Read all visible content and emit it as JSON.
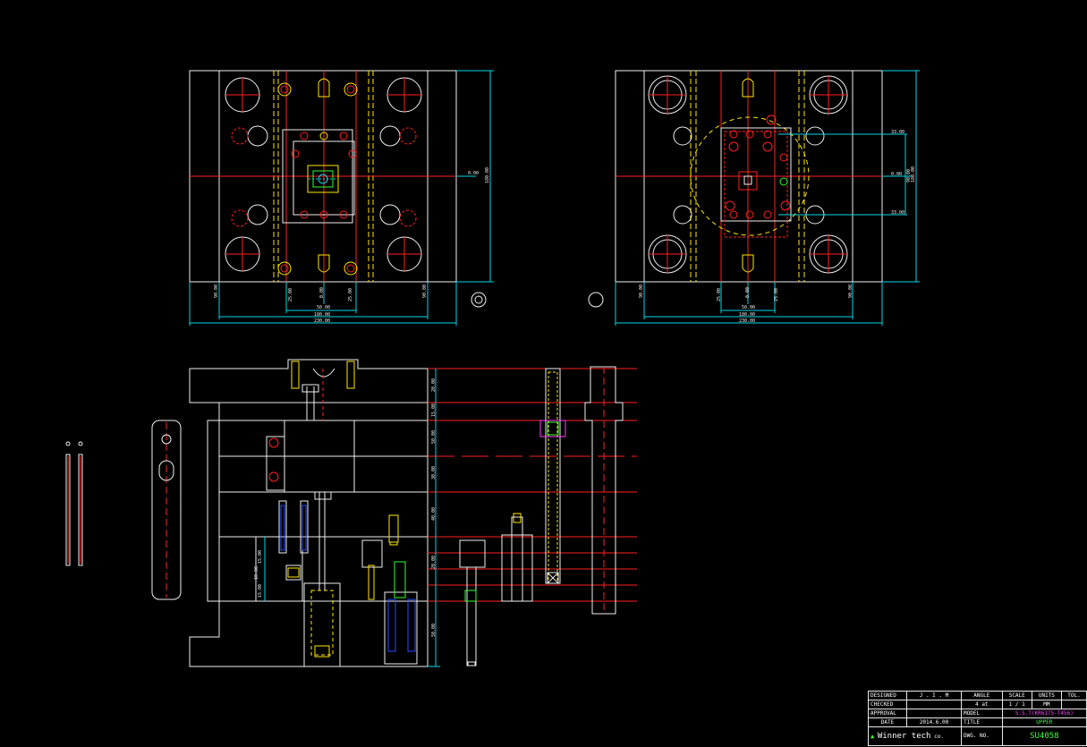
{
  "drawing": {
    "background": "#000000",
    "colors": {
      "red": "#ff2020",
      "yellow": "#ffe800",
      "cyan": "#00d8e8",
      "white": "#f0f0f0",
      "green": "#30ff30",
      "magenta": "#ff40ff",
      "blue": "#2a4cff"
    },
    "top_left_view": {
      "dims_bottom": [
        "90.00",
        "25.00",
        "0.00",
        "25.00",
        "90.00"
      ],
      "dims_total": [
        "50.00",
        "180.00",
        "230.00"
      ],
      "dims_right": [
        "0.00",
        "180.00"
      ]
    },
    "top_right_view": {
      "dims_bottom": [
        "90.00",
        "25.00",
        "0.00",
        "25.00",
        "90.00"
      ],
      "dims_total": [
        "50.00",
        "180.00",
        "230.00"
      ],
      "dims_right": [
        "33.00",
        "0.00",
        "33.00",
        "90.00",
        "180.00"
      ]
    },
    "section_view": {
      "dims_right": [
        "20.00",
        "15.00",
        "50.00",
        "30.00",
        "40.00",
        "20.00",
        "50.00"
      ],
      "dims_left": [
        "15.00",
        "15.00",
        "10.00"
      ]
    }
  },
  "title_block": {
    "designed_label": "DESIGNED",
    "designed_value": "J . I . M",
    "checked_label": "CHECKED",
    "approval_label": "APPROVAL",
    "date_label": "DATE",
    "date_value": "2014.6.00",
    "angle_label": "ANGLE",
    "angle_value": "4 at",
    "scale_label": "SCALE",
    "scale_value": "1 / 1",
    "units_label": "UNITS",
    "units_value": "MM",
    "tol_label": "TOL.",
    "model_label": "MODEL",
    "model_value": "S.S.T(KR6175-T456)",
    "title_label": "TITLE",
    "title_value": "UPPER",
    "dwg_label": "DWG. NO.",
    "dwg_value": "SU4058",
    "company": "Winner tech",
    "company_sub": "co."
  }
}
